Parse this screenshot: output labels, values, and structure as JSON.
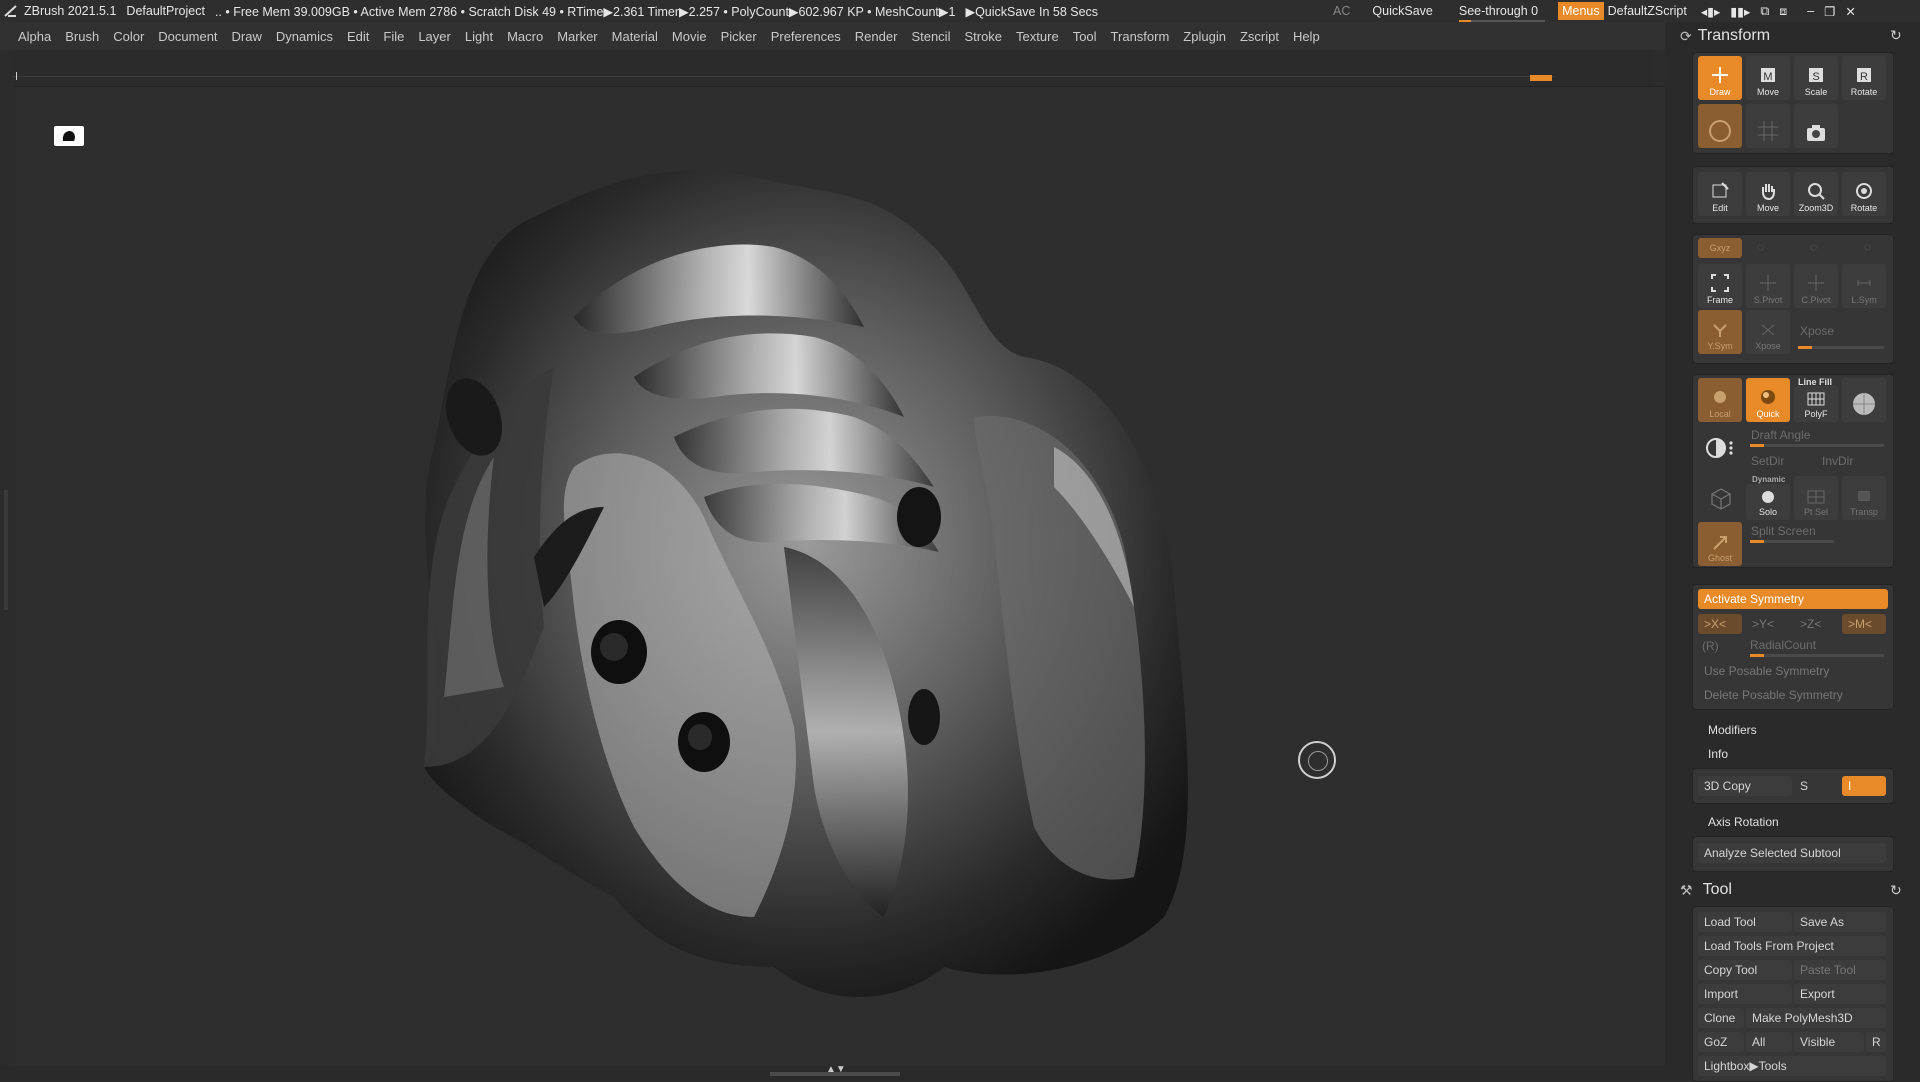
{
  "titlebar": {
    "app": "ZBrush 2021.5.1",
    "project": "DefaultProject",
    "stats": ".. • Free Mem 39.009GB • Active Mem 2786 • Scratch Disk 49 • RTime▶2.361 Timer▶2.257 • PolyCount▶602.967 KP • MeshCount▶1",
    "quicksave_timer": "▶QuickSave In 58 Secs",
    "ac": "AC",
    "quicksave": "QuickSave",
    "see_through": "See-through  0",
    "menus": "Menus",
    "zscript": "DefaultZScript"
  },
  "menu": [
    "Alpha",
    "Brush",
    "Color",
    "Document",
    "Draw",
    "Dynamics",
    "Edit",
    "File",
    "Layer",
    "Light",
    "Macro",
    "Marker",
    "Material",
    "Movie",
    "Picker",
    "Preferences",
    "Render",
    "Stencil",
    "Stroke",
    "Texture",
    "Tool",
    "Transform",
    "Zplugin",
    "Zscript",
    "Help"
  ],
  "transform": {
    "title": "Transform",
    "row1": [
      "Draw",
      "Move",
      "Scale",
      "Rotate"
    ],
    "row3": [
      "Edit",
      "Move",
      "Zoom3D",
      "Rotate"
    ],
    "xyz": "Gxyz",
    "row5": [
      "Frame",
      "S.Pivot",
      "C.Pivot",
      "L.Sym"
    ],
    "ysym": "Y.Sym",
    "xpose_small": "Xpose",
    "xpose": "Xpose",
    "linefill": "Line Fill",
    "local": "Local",
    "quick": "Quick",
    "polyf": "PolyF",
    "draft_angle": "Draft Angle",
    "setdir": "SetDir",
    "invdir": "InvDir",
    "dynamic": "Dynamic",
    "solo": "Solo",
    "ptsel": "Pt Sel",
    "transp": "Transp",
    "split_screen": "Split Screen",
    "ghost": "Ghost",
    "activate_symmetry": "Activate Symmetry",
    "axes": [
      ">X<",
      ">Y<",
      ">Z<",
      ">M<"
    ],
    "r": "(R)",
    "radialcount": "RadialCount",
    "use_posable": "Use Posable Symmetry",
    "delete_posable": "Delete Posable Symmetry",
    "modifiers": "Modifiers",
    "info": "Info",
    "copy3d": "3D Copy",
    "s": "S",
    "i": "I",
    "axis_rotation": "Axis Rotation",
    "analyze": "Analyze Selected Subtool"
  },
  "tool": {
    "title": "Tool",
    "load_tool": "Load Tool",
    "save_as": "Save As",
    "load_from_project": "Load Tools From Project",
    "copy_tool": "Copy Tool",
    "paste_tool": "Paste Tool",
    "import": "Import",
    "export": "Export",
    "clone": "Clone",
    "make_polymesh": "Make PolyMesh3D",
    "goz": "GoZ",
    "all": "All",
    "visible": "Visible",
    "r": "R",
    "lightbox_tools": "Lightbox▶Tools"
  },
  "colors": {
    "accent": "#e88a27",
    "panel": "#2a2a2a",
    "viewport": "#2e2e2e"
  }
}
